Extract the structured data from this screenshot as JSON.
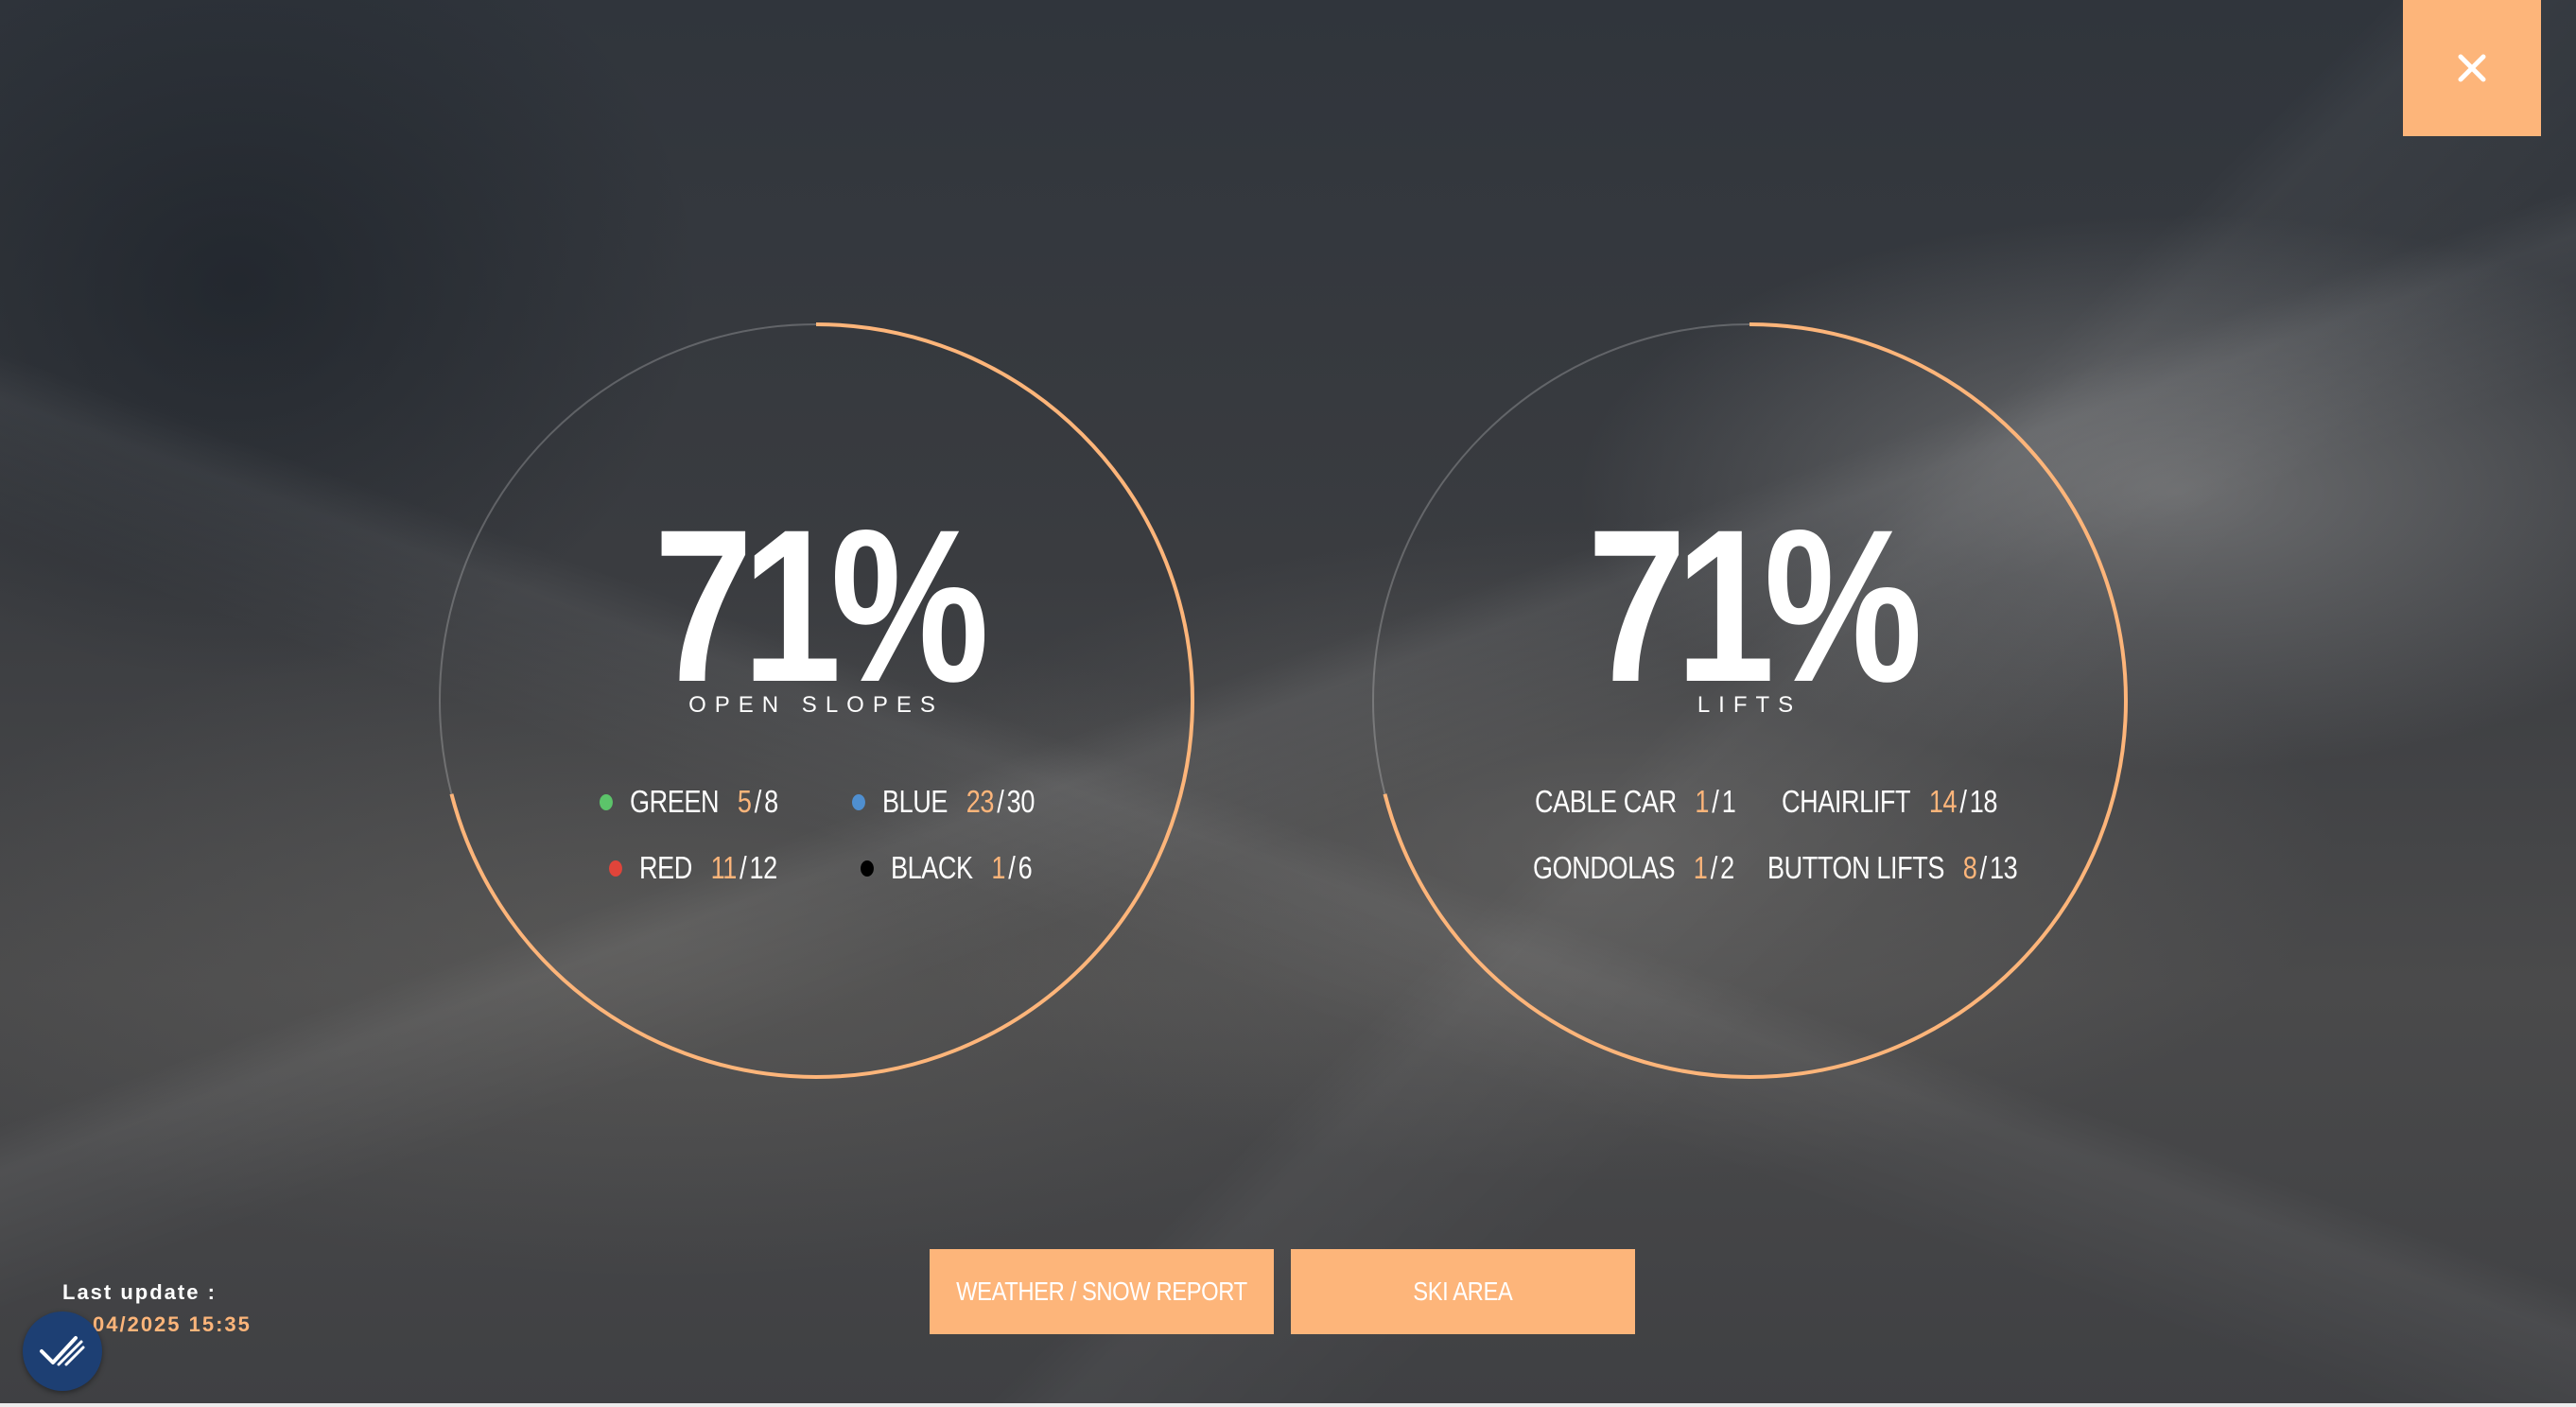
{
  "theme": {
    "accent": "#fdb57a",
    "badge": "#1d3f73"
  },
  "close_button": {
    "icon": "close-icon"
  },
  "slopes": {
    "percent": "71%",
    "fraction": 0.71,
    "caption": "OPEN SLOPES",
    "items": [
      {
        "name": "GREEN",
        "open": "5",
        "total": "8",
        "color": "#5cc46a"
      },
      {
        "name": "BLUE",
        "open": "23",
        "total": "30",
        "color": "#4f8fd0"
      },
      {
        "name": "RED",
        "open": "11",
        "total": "12",
        "color": "#e0443a"
      },
      {
        "name": "BLACK",
        "open": "1",
        "total": "6",
        "color": "#000000"
      }
    ]
  },
  "lifts": {
    "percent": "71%",
    "fraction": 0.71,
    "caption": "LIFTS",
    "items": [
      {
        "name": "CABLE CAR",
        "open": "1",
        "total": "1"
      },
      {
        "name": "CHAIRLIFT",
        "open": "14",
        "total": "18"
      },
      {
        "name": "GONDOLAS",
        "open": "1",
        "total": "2"
      },
      {
        "name": "BUTTON LIFTS",
        "open": "8",
        "total": "13"
      }
    ]
  },
  "buttons": {
    "weather": "WEATHER / SNOW REPORT",
    "ski_area": "SKI AREA"
  },
  "update": {
    "label": "Last update :",
    "value": "04/2025 15:35"
  },
  "badge": {
    "icon": "checkmark-icon"
  }
}
